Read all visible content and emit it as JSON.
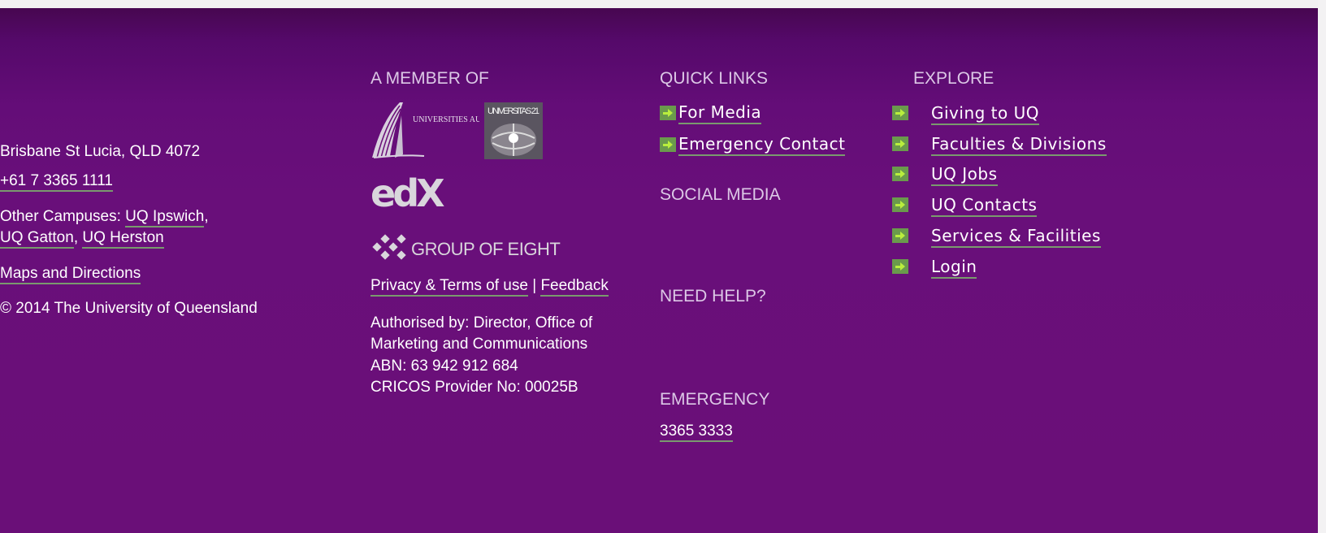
{
  "address": {
    "line1": "Brisbane St Lucia, QLD 4072",
    "phone": "+61 7 3365 1111",
    "campuses_prefix": "Other Campuses: ",
    "campus_ipswich": "UQ Ipswich",
    "campus_gatton": "UQ Gatton",
    "campus_herston": "UQ Herston",
    "maps": "Maps and Directions",
    "copyright": "© 2014 The University of Queensland"
  },
  "member": {
    "heading": "A MEMBER OF",
    "universities_australia_text": "UNIVERSITIES AUSTRALIA",
    "universitas_text": "UNIVERSITAS 21",
    "edx_text": "edX",
    "go8_text": "GROUP OF EIGHT",
    "privacy": "Privacy & Terms of use",
    "separator": "|",
    "feedback": "Feedback",
    "authorised_line1": "Authorised by: Director, Office of",
    "authorised_line2": "Marketing and Communications",
    "abn": "ABN: 63 942 912 684",
    "cricos": "CRICOS Provider No: 00025B"
  },
  "quick_links": {
    "heading": "QUICK LINKS",
    "items": [
      {
        "label": "For Media"
      },
      {
        "label": "Emergency Contact"
      }
    ]
  },
  "social": {
    "heading": "SOCIAL MEDIA"
  },
  "help": {
    "heading": "NEED HELP?"
  },
  "emergency": {
    "heading": "EMERGENCY",
    "number": "3365 3333"
  },
  "explore": {
    "heading": "EXPLORE",
    "items": [
      {
        "label": "Giving to UQ"
      },
      {
        "label": "Faculties & Divisions"
      },
      {
        "label": "UQ Jobs"
      },
      {
        "label": "UQ Contacts"
      },
      {
        "label": "Services & Facilities"
      },
      {
        "label": "Login"
      }
    ]
  },
  "colors": {
    "footer_bg": "#6a0f78",
    "heading": "#dcc8e6",
    "link_underline": "#7a9a6e",
    "arrow_bg": "#6a9a4c",
    "arrow_fg": "#b9ee3d"
  },
  "icons": [
    "arrow-right-icon"
  ]
}
